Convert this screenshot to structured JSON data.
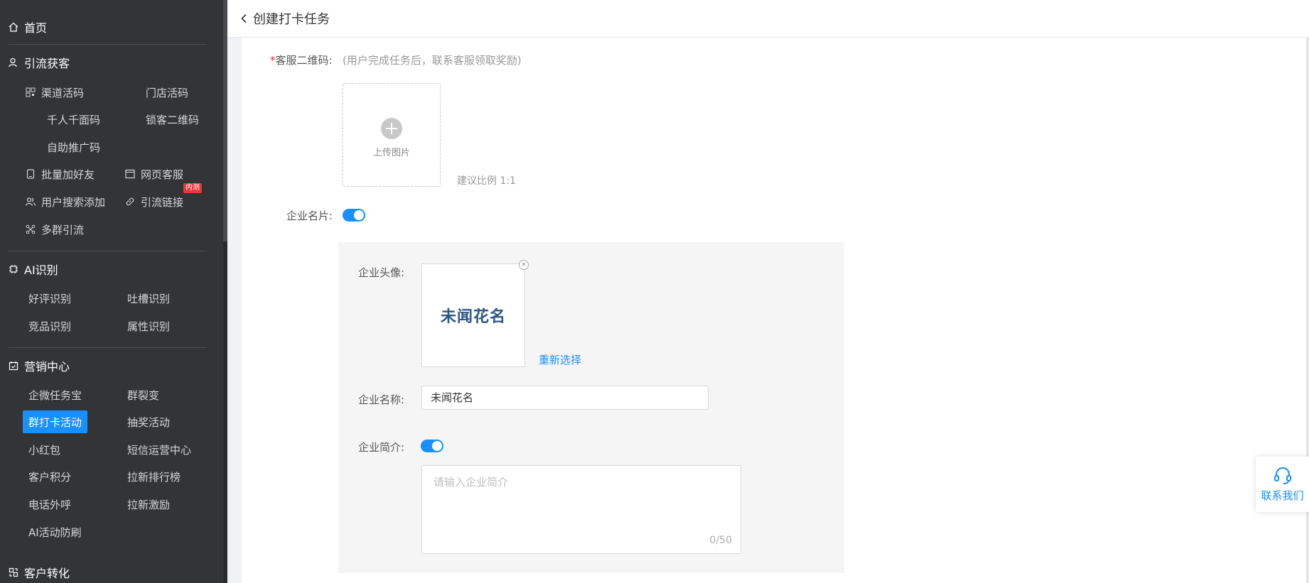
{
  "sidebar": {
    "home": "首页",
    "sections": {
      "traffic": {
        "title": "引流获客",
        "items": [
          "渠道活码",
          "门店活码",
          "千人千面码",
          "锁客二维码",
          "自助推广码",
          "批量加好友",
          "网页客服",
          "用户搜索添加",
          "引流链接",
          "多群引流"
        ],
        "badge": "内测"
      },
      "ai": {
        "title": "AI识别",
        "items": [
          "好评识别",
          "吐槽识别",
          "竞品识别",
          "属性识别"
        ]
      },
      "marketing": {
        "title": "营销中心",
        "items": [
          "企微任务宝",
          "群裂变",
          "群打卡活动",
          "抽奖活动",
          "小红包",
          "短信运营中心",
          "客户积分",
          "拉新排行榜",
          "电话外呼",
          "拉新激励",
          "AI活动防刷"
        ]
      },
      "conversion": {
        "title": "客户转化"
      }
    }
  },
  "header": {
    "title": "创建打卡任务"
  },
  "form": {
    "qrcode": {
      "required_mark": "*",
      "label": "客服二维码:",
      "hint": "(用户完成任务后，联系客服领取奖励)",
      "upload_text": "上传图片",
      "ratio_hint": "建议比例 1:1"
    },
    "business_card": {
      "label": "企业名片:",
      "enabled": true
    },
    "avatar": {
      "label": "企业头像:",
      "image_text": "未闻花名",
      "reselect": "重新选择"
    },
    "company_name": {
      "label": "企业名称:",
      "value": "未闻花名"
    },
    "company_intro": {
      "label": "企业简介:",
      "enabled": true,
      "placeholder": "请输入企业简介",
      "counter": "0/50"
    }
  },
  "contact": {
    "label": "联系我们"
  },
  "colors": {
    "accent": "#1890ff",
    "sidebar_bg": "#333436",
    "badge": "#e8363a"
  }
}
